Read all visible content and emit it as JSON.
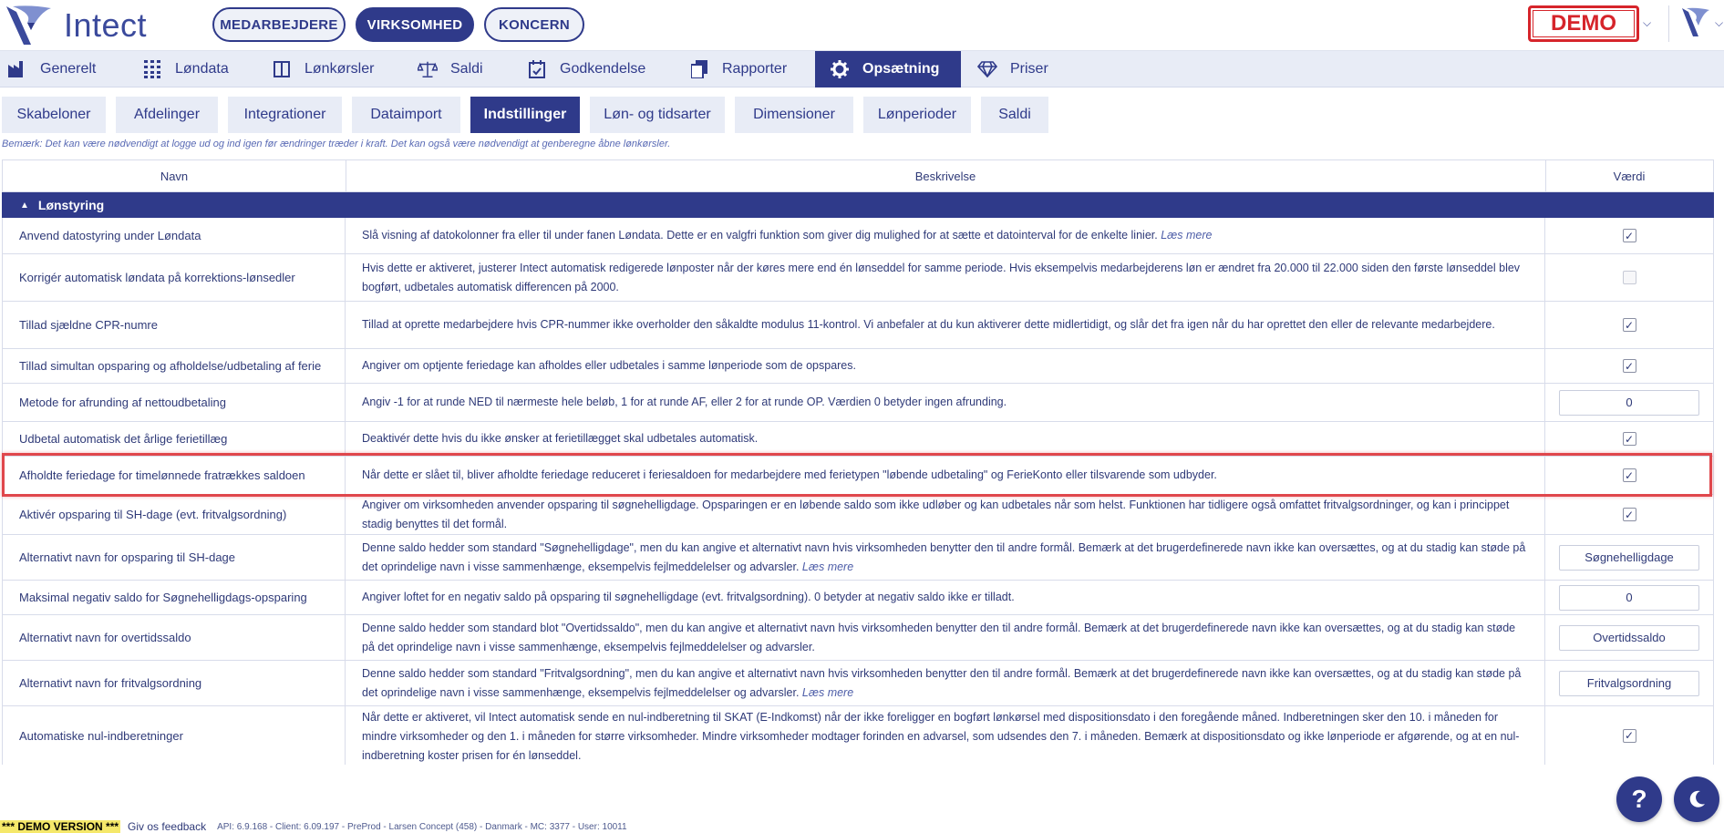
{
  "header": {
    "app_name": "Intect",
    "scope_tabs": [
      "MEDARBEJDERE",
      "VIRKSOMHED",
      "KONCERN"
    ],
    "demo_badge": "DEMO"
  },
  "main_nav": [
    {
      "label": "Generelt",
      "icon": "factory-icon"
    },
    {
      "label": "Løndata",
      "icon": "grid-icon"
    },
    {
      "label": "Lønkørsler",
      "icon": "columns-icon"
    },
    {
      "label": "Saldi",
      "icon": "scale-icon"
    },
    {
      "label": "Godkendelse",
      "icon": "calendar-check-icon"
    },
    {
      "label": "Rapporter",
      "icon": "documents-icon"
    },
    {
      "label": "Opsætning",
      "icon": "gear-icon"
    },
    {
      "label": "Priser",
      "icon": "diamond-icon"
    }
  ],
  "sub_tabs": [
    "Skabeloner",
    "Afdelinger",
    "Integrationer",
    "Dataimport",
    "Indstillinger",
    "Løn- og tidsarter",
    "Dimensioner",
    "Lønperioder",
    "Saldi"
  ],
  "note": "Bemærk: Det kan være nødvendigt at logge ud og ind igen før ændringer træder i kraft. Det kan også være nødvendigt at genberegne åbne lønkørsler.",
  "table": {
    "col_name": "Navn",
    "col_desc": "Beskrivelse",
    "col_value": "Værdi",
    "group": "Lønstyring",
    "read_more": "Læs mere",
    "rows": [
      {
        "name": "Anvend datostyring under Løndata",
        "desc": "Slå visning af datokolonner fra eller til under fanen Løndata. Dette er en valgfri funktion som giver dig mulighed for at sætte et datointerval for de enkelte linier.",
        "checked": true
      },
      {
        "name": "Korrigér automatisk løndata på korrektions-lønsedler",
        "desc": "Hvis dette er aktiveret, justerer Intect automatisk redigerede lønposter når der køres mere end én lønseddel for samme periode. Hvis eksempelvis medarbejderens løn er ændret fra 20.000 til 22.000 siden den første lønseddel blev bogført, udbetales automatisk differencen på 2000.",
        "checked": false
      },
      {
        "name": "Tillad sjældne CPR-numre",
        "desc": "Tillad at oprette medarbejdere hvis CPR-nummer ikke overholder den såkaldte modulus 11-kontrol. Vi anbefaler at du kun aktiverer dette midlertidigt, og slår det fra igen når du har oprettet den eller de relevante medarbejdere.",
        "checked": true
      },
      {
        "name": "Tillad simultan opsparing og afholdelse/udbetaling af ferie",
        "desc": "Angiver om optjente feriedage kan afholdes eller udbetales i samme lønperiode som de opspares.",
        "checked": true
      },
      {
        "name": "Metode for afrunding af nettoudbetaling",
        "desc": "Angiv -1 for at runde NED til nærmeste hele beløb, 1 for at runde AF, eller 2 for at runde OP. Værdien 0 betyder ingen afrunding.",
        "value": "0"
      },
      {
        "name": "Udbetal automatisk det årlige ferietillæg",
        "desc": "Deaktivér dette hvis du ikke ønsker at ferietillægget skal udbetales automatisk.",
        "checked": true
      },
      {
        "name": "Afholdte feriedage for timelønnede fratrækkes saldoen",
        "desc": "Når dette er slået til, bliver afholdte feriedage reduceret i feriesaldoen for medarbejdere med ferietypen \"løbende udbetaling\" og FerieKonto eller tilsvarende som udbyder.",
        "checked": true
      },
      {
        "name": "Aktivér opsparing til SH-dage (evt. fritvalgsordning)",
        "desc": "Angiver om virksomheden anvender opsparing til søgnehelligdage. Opsparingen er en løbende saldo som ikke udløber og kan udbetales når som helst. Funktionen har tidligere også omfattet fritvalgsordninger, og kan i princippet stadig benyttes til det formål.",
        "checked": true
      },
      {
        "name": "Alternativt navn for opsparing til SH-dage",
        "desc": "Denne saldo hedder som standard \"Søgnehelligdage\", men du kan angive et alternativt navn hvis virksomheden benytter den til andre formål. Bemærk at det brugerdefinerede navn ikke kan oversættes, og at du stadig kan støde på det oprindelige navn i visse sammenhænge, eksempelvis fejlmeddelelser og advarsler.",
        "value": "Søgnehelligdage"
      },
      {
        "name": "Maksimal negativ saldo for Søgnehelligdags-opsparing",
        "desc": "Angiver loftet for en negativ saldo på opsparing til søgnehelligdage (evt. fritvalgsordning). 0 betyder at negativ saldo ikke er tilladt.",
        "value": "0"
      },
      {
        "name": "Alternativt navn for overtidssaldo",
        "desc": "Denne saldo hedder som standard blot \"Overtidssaldo\", men du kan angive et alternativt navn hvis virksomheden benytter den til andre formål. Bemærk at det brugerdefinerede navn ikke kan oversættes, og at du stadig kan støde på det oprindelige navn i visse sammenhænge, eksempelvis fejlmeddelelser og advarsler.",
        "value": "Overtidssaldo"
      },
      {
        "name": "Alternativt navn for fritvalgsordning",
        "desc": "Denne saldo hedder som standard \"Fritvalgsordning\", men du kan angive et alternativt navn hvis virksomheden benytter den til andre formål. Bemærk at det brugerdefinerede navn ikke kan oversættes, og at du stadig kan støde på det oprindelige navn i visse sammenhænge, eksempelvis fejlmeddelelser og advarsler.",
        "value": "Fritvalgsordning"
      },
      {
        "name": "Automatiske nul-indberetninger",
        "desc": "Når dette er aktiveret, vil Intect automatisk sende en nul-indberetning til SKAT (E-Indkomst) når der ikke foreligger en bogført lønkørsel med dispositionsdato i den foregående måned. Indberetningen sker den 10. i måneden for mindre virksomheder og den 1. i måneden for større virksomheder. Mindre virksomheder modtager forinden en advarsel, som udsendes den 7. i måneden. Bemærk at dispositionsdato og ikke lønperiode er afgørende, og at en nul-indberetning koster prisen for én lønseddel.",
        "checked": true
      }
    ]
  },
  "footer": {
    "demo_version": "*** DEMO VERSION ***",
    "feedback": "Giv os feedback",
    "meta": "API: 6.9.168 - Client: 6.09.197 - PreProd - Larsen Concept (458) - Danmark - MC: 3377 - User: 10011"
  },
  "help_button": "?",
  "colors": {
    "primary": "#2f3a8a",
    "nav_bg": "#e8ecf6",
    "demo_red": "#d6252b",
    "highlight": "#e0474c"
  }
}
